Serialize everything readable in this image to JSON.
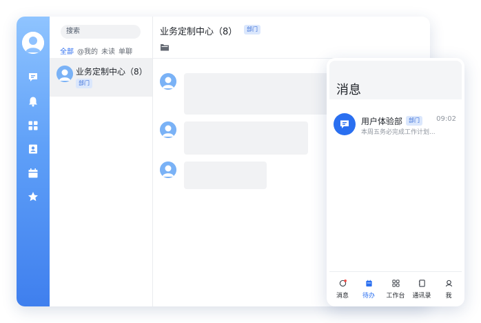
{
  "desktop": {
    "search": {
      "placeholder": "搜索"
    },
    "filters": [
      {
        "label": "全部",
        "active": true
      },
      {
        "label": "@我的",
        "active": false
      },
      {
        "label": "未读",
        "active": false
      },
      {
        "label": "单聊",
        "active": false
      }
    ],
    "conversation": {
      "name": "业务定制中心（8）",
      "tag": "部门"
    },
    "chat": {
      "title": "业务定制中心（8）",
      "tag": "部门"
    },
    "rail_icons": [
      "chat-icon",
      "bell-icon",
      "apps-icon",
      "contacts-icon",
      "calendar-icon",
      "star-icon"
    ]
  },
  "mobile": {
    "title": "消息",
    "item": {
      "name": "用户体验部",
      "tag": "部门",
      "time": "09:02",
      "preview": "本周五务必完成工作计划..."
    },
    "tabs": [
      {
        "label": "消息",
        "icon": "message-icon",
        "active": false,
        "has_badge": true
      },
      {
        "label": "待办",
        "icon": "todo-icon",
        "active": true,
        "has_badge": false
      },
      {
        "label": "工作台",
        "icon": "workbench-icon",
        "active": false,
        "has_badge": false
      },
      {
        "label": "通讯录",
        "icon": "contacts-icon",
        "active": false,
        "has_badge": false
      },
      {
        "label": "我",
        "icon": "me-icon",
        "active": false,
        "has_badge": false
      }
    ]
  },
  "colors": {
    "accent": "#2a6ff0",
    "rail_top": "#8fc4ff",
    "rail_bottom": "#3f7fee",
    "tag_bg": "#dbe7fc",
    "badge": "#f54a45"
  }
}
